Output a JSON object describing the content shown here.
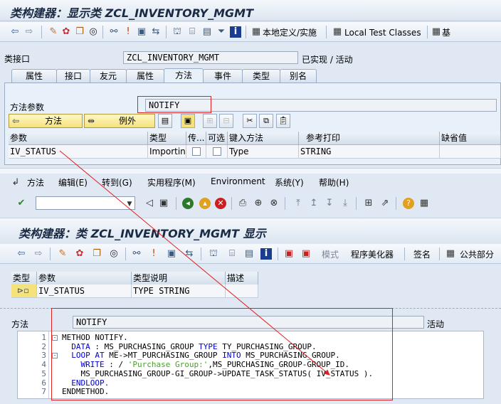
{
  "window_title": "类构建器：显示类 ZCL_INVENTORY_MGMT",
  "toolbar1": {
    "local_def_label": "本地定义/实施",
    "local_test_label": "Local Test Classes",
    "base_label": "基"
  },
  "class_interface": {
    "label": "类接口",
    "value": "ZCL_INVENTORY_MGMT",
    "status": "已实现 / 活动"
  },
  "tabs": [
    "属性",
    "接口",
    "友元",
    "属性",
    "方法",
    "事件",
    "类型",
    "别名"
  ],
  "active_tab_index": 4,
  "method_params": {
    "label": "方法参数",
    "value": "NOTIFY",
    "btn_methods": "方法",
    "btn_exceptions": "例外"
  },
  "param_table": {
    "headers": [
      "参数",
      "类型",
      "传...",
      "可选",
      "键入方法",
      "参考打印",
      "缺省值"
    ],
    "row": {
      "param": "IV_STATUS",
      "type": "Importin...",
      "typing": "Type",
      "ref": "STRING"
    }
  },
  "menu": {
    "items": [
      "方法",
      "编辑(E)",
      "转到(G)",
      "实用程序(M)",
      "Environment",
      "系统(Y)",
      "帮助(H)"
    ]
  },
  "section2_title": "类构建器：类 ZCL_INVENTORY_MGMT 显示",
  "toolbar2": {
    "pattern_label": "模式",
    "pretty_printer_label": "程序美化器",
    "signature_label": "签名",
    "public_section_label": "公共部分"
  },
  "signature_table": {
    "headers": [
      "类型",
      "参数",
      "类型说明",
      "描述"
    ],
    "row": {
      "param": "IV_STATUS",
      "desc": "TYPE STRING"
    }
  },
  "method_field": {
    "label": "方法",
    "value": "NOTIFY",
    "status": "活动"
  },
  "code": {
    "lines": [
      {
        "n": "1",
        "fold": "-",
        "parts": [
          {
            "t": "METHOD NOTIFY.",
            "c": ""
          }
        ]
      },
      {
        "n": "2",
        "fold": "",
        "parts": [
          {
            "t": "  DATA",
            "c": "kw"
          },
          {
            "t": " : MS_PURCHASING_GROUP ",
            "c": ""
          },
          {
            "t": "TYPE",
            "c": "kw"
          },
          {
            "t": " TY_PURCHASING_GROUP.",
            "c": ""
          }
        ]
      },
      {
        "n": "3",
        "fold": "-",
        "parts": [
          {
            "t": "  LOOP AT",
            "c": "kw"
          },
          {
            "t": " ME->MT_PURCHASING_GROUP ",
            "c": ""
          },
          {
            "t": "INTO",
            "c": "kw"
          },
          {
            "t": " MS_PURCHASING_GROUP.",
            "c": ""
          }
        ]
      },
      {
        "n": "4",
        "fold": "",
        "parts": [
          {
            "t": "    WRITE",
            "c": "kw"
          },
          {
            "t": " : / ",
            "c": ""
          },
          {
            "t": "'Purchase Group:'",
            "c": "str"
          },
          {
            "t": ",MS_PURCHASING_GROUP-GROUP_ID.",
            "c": ""
          }
        ]
      },
      {
        "n": "5",
        "fold": "",
        "parts": [
          {
            "t": "    MS_PURCHASING_GROUP-GI_GROUP->UPDATE_TASK_STATUS( IV_STATUS ).",
            "c": ""
          }
        ]
      },
      {
        "n": "6",
        "fold": "",
        "parts": [
          {
            "t": "  ENDLOOP.",
            "c": "kw"
          }
        ]
      },
      {
        "n": "7",
        "fold": "",
        "parts": [
          {
            "t": "ENDMETHOD.",
            "c": ""
          }
        ]
      }
    ]
  }
}
